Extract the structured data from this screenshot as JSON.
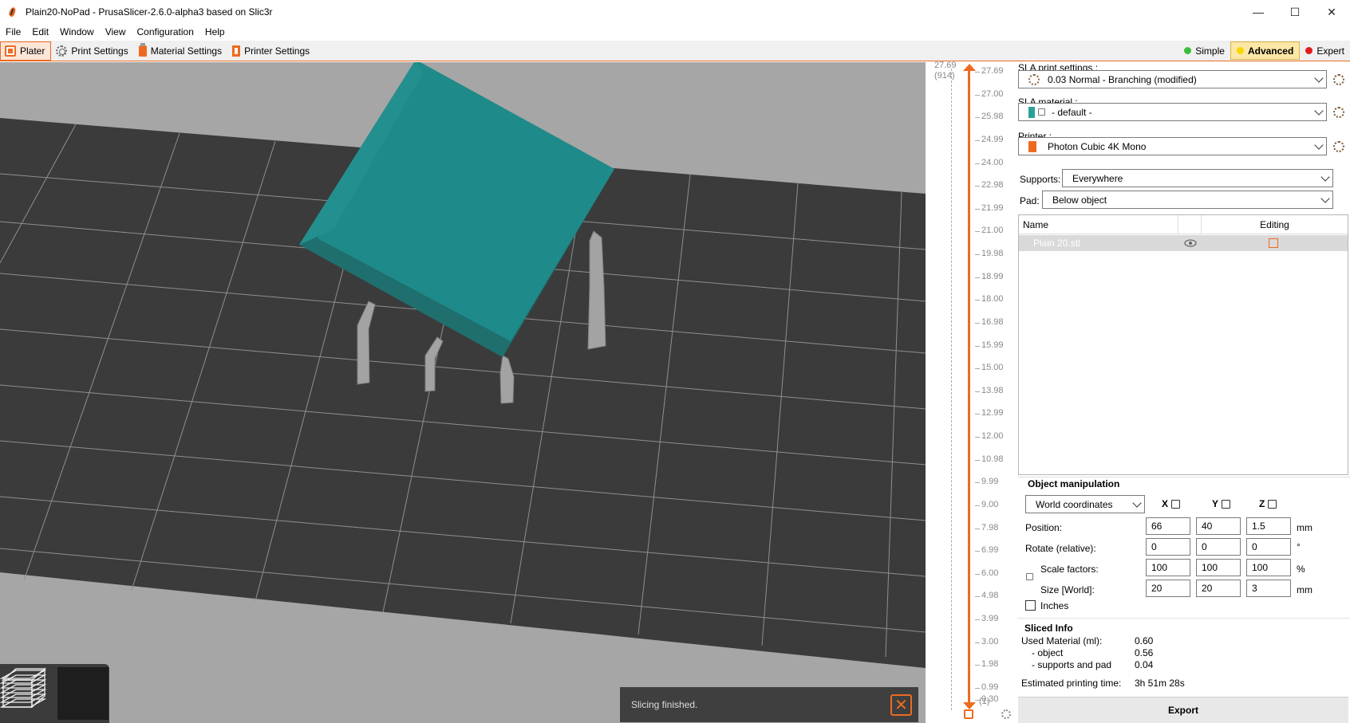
{
  "window": {
    "title": "Plain20-NoPad - PrusaSlicer-2.6.0-alpha3 based on Slic3r",
    "minimize": "—",
    "maximize": "☐",
    "close": "✕"
  },
  "menu": [
    "File",
    "Edit",
    "Window",
    "View",
    "Configuration",
    "Help"
  ],
  "tabs": [
    {
      "label": "Plater",
      "icon": "plater-icon"
    },
    {
      "label": "Print Settings",
      "icon": "gear-icon"
    },
    {
      "label": "Material Settings",
      "icon": "bottle-icon"
    },
    {
      "label": "Printer Settings",
      "icon": "printer-icon"
    }
  ],
  "modes": [
    {
      "label": "Simple",
      "color": "#3dbd3d"
    },
    {
      "label": "Advanced",
      "color": "#f5d800"
    },
    {
      "label": "Expert",
      "color": "#e31b1b"
    }
  ],
  "viewport": {
    "toast_text": "Slicing finished.",
    "object_color": "#1f8a8a",
    "bed_color": "#3b3b3b"
  },
  "slider": {
    "top_value": "27.69",
    "top_layer": "(914)",
    "bottom_value": "0.30",
    "bottom_layer": "(1)",
    "ticks": [
      "27.69",
      "27.00",
      "25.98",
      "24.99",
      "24.00",
      "22.98",
      "21.99",
      "21.00",
      "19.98",
      "18.99",
      "18.00",
      "16.98",
      "15.99",
      "15.00",
      "13.98",
      "12.99",
      "12.00",
      "10.98",
      "9.99",
      "9.00",
      "7.98",
      "6.99",
      "6.00",
      "4.98",
      "3.99",
      "3.00",
      "1.98",
      "0.99",
      "0.30"
    ]
  },
  "sidebar": {
    "print_label": "SLA print settings :",
    "print_value": "0.03 Normal - Branching (modified)",
    "material_label": "SLA material :",
    "material_value": "- default -",
    "printer_label": "Printer :",
    "printer_value": "Photon Cubic 4K Mono",
    "supports_label": "Supports:",
    "supports_value": "Everywhere",
    "pad_label": "Pad:",
    "pad_value": "Below object",
    "list_name_header": "Name",
    "list_editing_header": "Editing",
    "object_name": "Plain 20.stl"
  },
  "manipulation": {
    "title": "Object manipulation",
    "coords": "World coordinates",
    "axes": [
      "X",
      "Y",
      "Z"
    ],
    "position_label": "Position:",
    "position": [
      "66",
      "40",
      "1.5"
    ],
    "position_unit": "mm",
    "rotate_label": "Rotate (relative):",
    "rotate": [
      "0",
      "0",
      "0"
    ],
    "rotate_unit": "°",
    "scale_label": "Scale factors:",
    "scale": [
      "100",
      "100",
      "100"
    ],
    "scale_unit": "%",
    "size_label": "Size [World]:",
    "size": [
      "20",
      "20",
      "3"
    ],
    "size_unit": "mm",
    "inches_label": "Inches"
  },
  "sliced_info": {
    "title": "Sliced Info",
    "used_material_label": "Used Material (ml):",
    "used_material": "0.60",
    "object_label": "- object",
    "object_value": "0.56",
    "supports_label": "- supports and pad",
    "supports_value": "0.04",
    "time_label": "Estimated printing time:",
    "time_value": "3h 51m 28s"
  },
  "export_label": "Export"
}
